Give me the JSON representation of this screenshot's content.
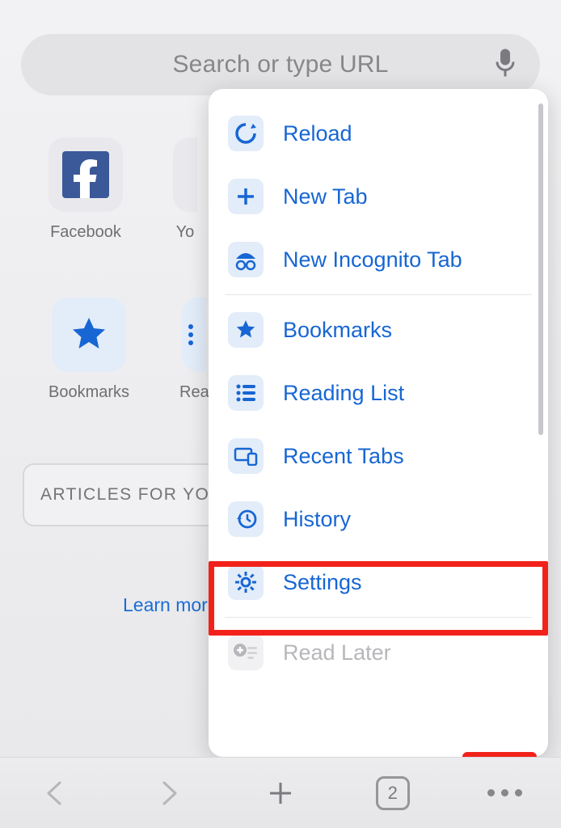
{
  "search": {
    "placeholder": "Search or type URL"
  },
  "tiles_row1": [
    {
      "label": "Facebook"
    },
    {
      "label": "Yo"
    }
  ],
  "tiles_row2": [
    {
      "label": "Bookmarks"
    },
    {
      "label": "Rea"
    }
  ],
  "articles_label": "ARTICLES FOR YO",
  "learn_more": "Learn mor",
  "menu": {
    "items": [
      {
        "label": "Reload"
      },
      {
        "label": "New Tab"
      },
      {
        "label": "New Incognito Tab"
      },
      {
        "label": "Bookmarks"
      },
      {
        "label": "Reading List"
      },
      {
        "label": "Recent Tabs"
      },
      {
        "label": "History"
      },
      {
        "label": "Settings"
      },
      {
        "label": "Read Later"
      }
    ]
  },
  "nav": {
    "tab_count": "2"
  }
}
